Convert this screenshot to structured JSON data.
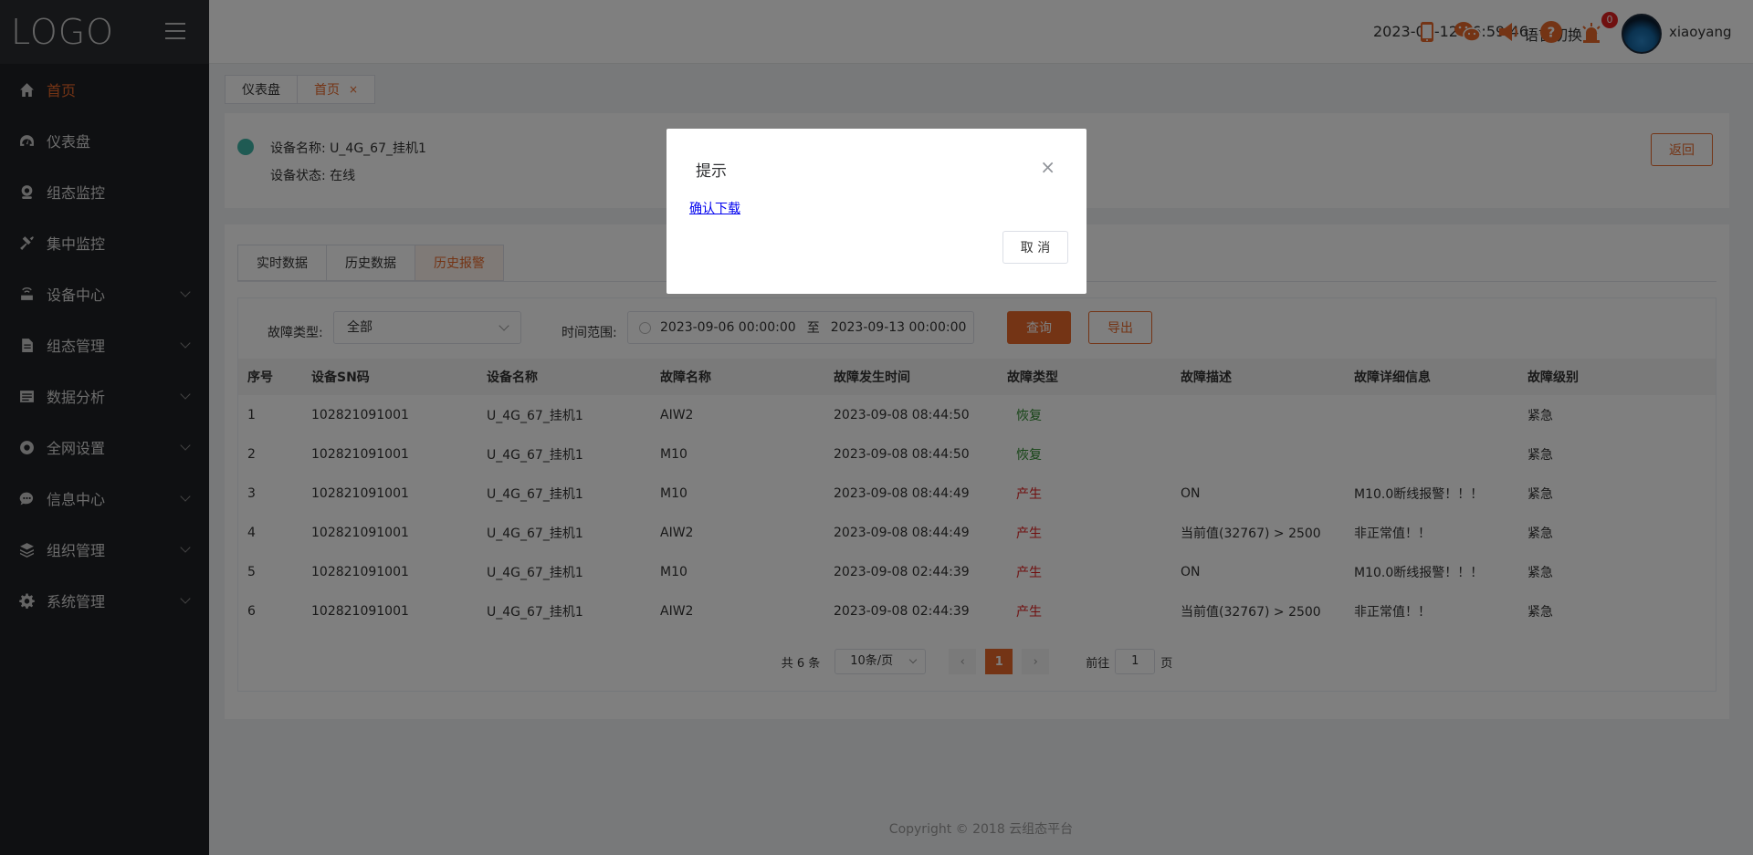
{
  "sidebar": {
    "logo": "LOGO",
    "items": [
      {
        "label": "首页",
        "icon": "home-icon"
      },
      {
        "label": "仪表盘",
        "icon": "dashboard-icon"
      },
      {
        "label": "组态监控",
        "icon": "webcam-icon"
      },
      {
        "label": "集中监控",
        "icon": "hammer-icon"
      },
      {
        "label": "设备中心",
        "icon": "router-icon"
      },
      {
        "label": "组态管理",
        "icon": "document-icon"
      },
      {
        "label": "数据分析",
        "icon": "chart-icon"
      },
      {
        "label": "全网设置",
        "icon": "settings-circle-icon"
      },
      {
        "label": "信息中心",
        "icon": "chat-icon"
      },
      {
        "label": "组织管理",
        "icon": "layers-icon"
      },
      {
        "label": "系统管理",
        "icon": "gear-icon"
      }
    ]
  },
  "header": {
    "datetime": "2023-09-12 16:59:46",
    "language": "语言切换",
    "alert_count": "0",
    "username": "xiaoyang"
  },
  "tabs": [
    {
      "label": "仪表盘"
    },
    {
      "label": "首页",
      "close": "×"
    }
  ],
  "device": {
    "name": "设备名称: U_4G_67_挂机1",
    "status": "设备状态: 在线",
    "back_label": "返回"
  },
  "subtabs": [
    "实时数据",
    "历史数据",
    "历史报警"
  ],
  "filters": {
    "fault_type_label": "故障类型:",
    "fault_type_value": "全部",
    "time_range_label": "时间范围:",
    "start": "2023-09-06 00:00:00",
    "separator": "至",
    "end": "2023-09-13 00:00:00",
    "query_label": "查询",
    "export_label": "导出"
  },
  "table": {
    "headers": [
      "序号",
      "设备SN码",
      "设备名称",
      "故障名称",
      "故障发生时间",
      "故障类型",
      "故障描述",
      "故障详细信息",
      "故障级别"
    ],
    "rows": [
      [
        "1",
        "102821091001",
        "U_4G_67_挂机1",
        "AIW2",
        "2023-09-08 08:44:50",
        "恢复",
        "",
        "",
        "紧急"
      ],
      [
        "2",
        "102821091001",
        "U_4G_67_挂机1",
        "M10",
        "2023-09-08 08:44:50",
        "恢复",
        "",
        "",
        "紧急"
      ],
      [
        "3",
        "102821091001",
        "U_4G_67_挂机1",
        "M10",
        "2023-09-08 08:44:49",
        "产生",
        "ON",
        "M10.0断线报警！！！",
        "紧急"
      ],
      [
        "4",
        "102821091001",
        "U_4G_67_挂机1",
        "AIW2",
        "2023-09-08 08:44:49",
        "产生",
        "当前值(32767) > 2500",
        "非正常值！！",
        "紧急"
      ],
      [
        "5",
        "102821091001",
        "U_4G_67_挂机1",
        "M10",
        "2023-09-08 02:44:39",
        "产生",
        "ON",
        "M10.0断线报警！！！",
        "紧急"
      ],
      [
        "6",
        "102821091001",
        "U_4G_67_挂机1",
        "AIW2",
        "2023-09-08 02:44:39",
        "产生",
        "当前值(32767) > 2500",
        "非正常值！！",
        "紧急"
      ]
    ]
  },
  "pagination": {
    "total": "共 6 条",
    "page_size": "10条/页",
    "prev": "‹",
    "current": "1",
    "next": "›",
    "goto_label": "前往",
    "goto_value": "1",
    "page_suffix": "页"
  },
  "footer": "Copyright © 2018 云组态平台",
  "dialog": {
    "title": "提示",
    "close": "×",
    "link": "确认下载",
    "cancel": "取 消"
  }
}
